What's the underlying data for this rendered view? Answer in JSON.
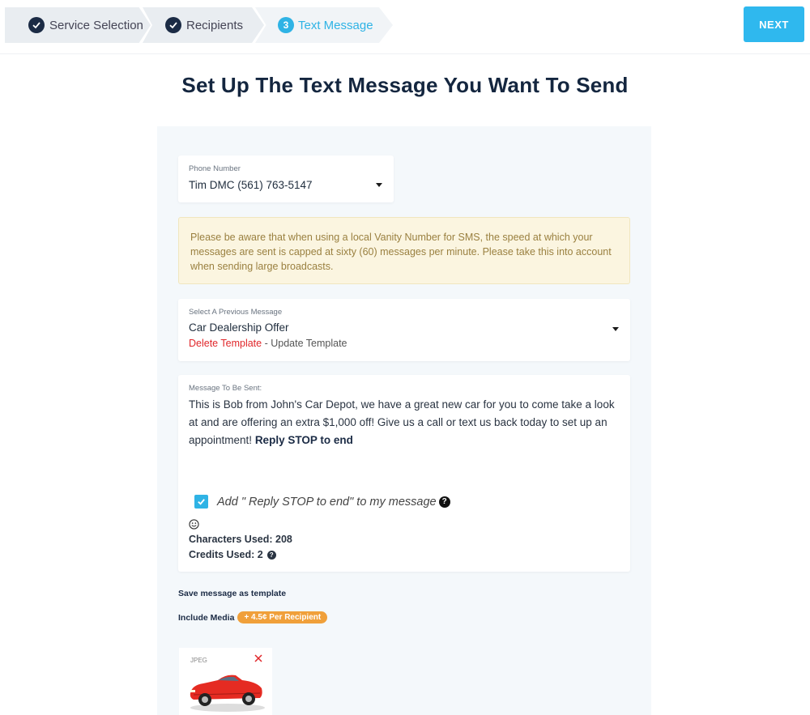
{
  "stepper": {
    "steps": [
      {
        "label": "Service Selection",
        "state": "complete"
      },
      {
        "label": "Recipients",
        "state": "complete"
      },
      {
        "label": "Text Message",
        "state": "active",
        "number": "3"
      }
    ]
  },
  "next_button": "NEXT",
  "page_title": "Set Up The Text Message You Want To Send",
  "phone": {
    "label": "Phone Number",
    "value": "Tim DMC (561) 763-5147"
  },
  "warning": "Please be aware that when using a local Vanity Number for SMS, the speed at which your messages are sent is capped at sixty (60) messages per minute. Please take this into account when sending large broadcasts.",
  "previous_message": {
    "label": "Select A Previous Message",
    "value": "Car Dealership Offer",
    "delete_link": "Delete Template",
    "separator": " - ",
    "update_link": "Update Template"
  },
  "message": {
    "label": "Message To Be Sent:",
    "text": "This is Bob from John's Car Depot, we have a great new car for you to come take a look at and are offering an extra $1,000 off! Give us a call or text us back today to set up an appointment! ",
    "suffix": "Reply STOP to end",
    "checkbox_label": "Add \" Reply STOP to end\" to my message",
    "checkbox_checked": true,
    "help_icon": "?",
    "characters_used": "Characters Used: 208",
    "credits_used": "Credits Used: 2"
  },
  "save_template": "Save message as template",
  "include_media": {
    "label": "Include Media",
    "badge": "+ 4.5¢ Per Recipient"
  },
  "media": {
    "file_type": "JPEG",
    "image_desc": "red-convertible-car"
  },
  "colors": {
    "accent": "#2fb8ee",
    "dark": "#1b2b45",
    "warning_bg": "#fbf5e0",
    "badge": "#f0a03a",
    "delete": "#e0262a"
  }
}
